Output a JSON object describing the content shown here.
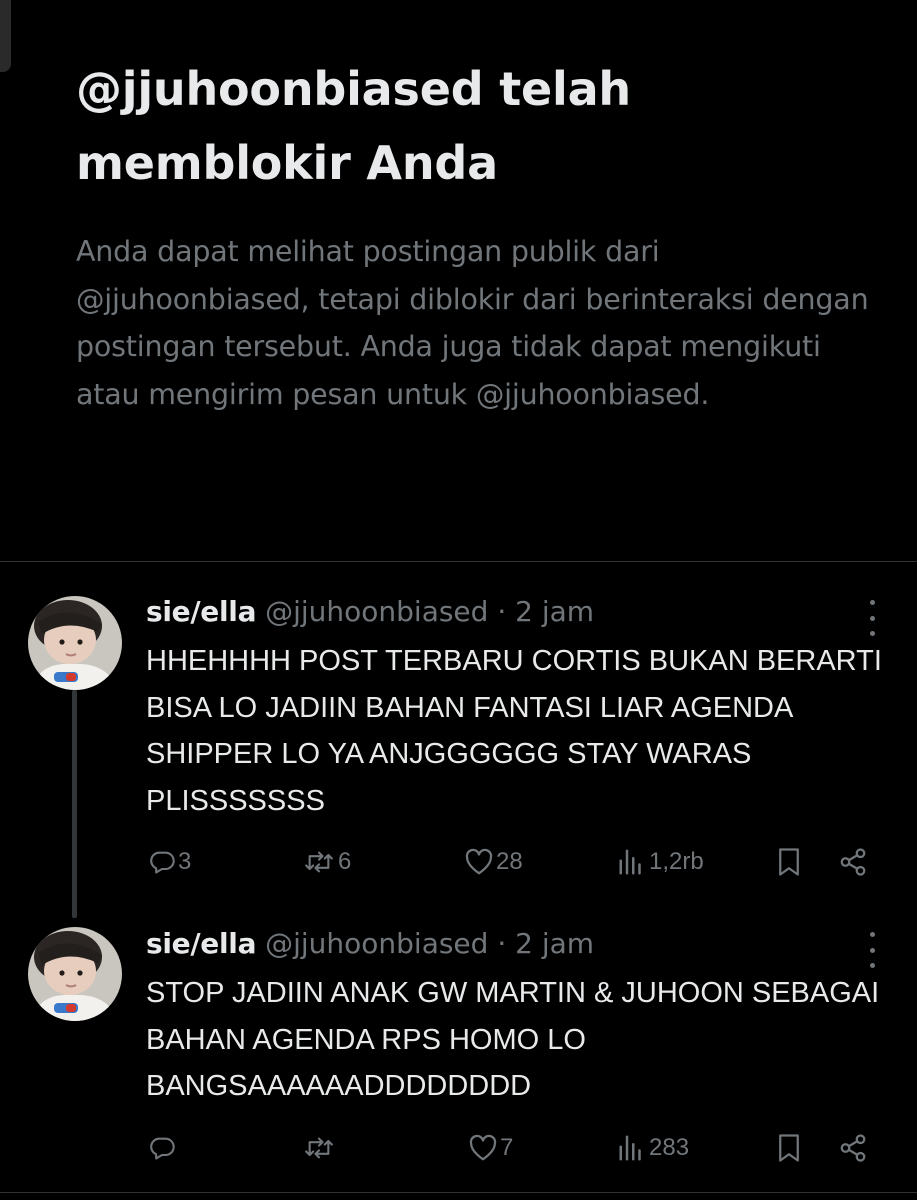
{
  "block_notice": {
    "title": "@jjuhoonbiased telah memblokir Anda",
    "description": "Anda dapat melihat postingan publik dari @jjuhoonbiased, tetapi diblokir dari berinteraksi dengan postingan tersebut. Anda juga tidak dapat mengikuti atau mengirim pesan untuk @jjuhoonbiased."
  },
  "tweets": [
    {
      "name": "sie/ella",
      "handle": "@jjuhoonbiased",
      "separator": "·",
      "time": "2 jam",
      "text": "HHEHHHH POST TERBARU CORTIS BUKAN BERARTI BISA LO JADIIN BAHAN FANTASI LIAR AGENDA SHIPPER LO YA ANJGGGGGG STAY WARAS PLISSSSSSS",
      "replies": "3",
      "reposts": "6",
      "likes": "28",
      "views": "1,2rb"
    },
    {
      "name": "sie/ella",
      "handle": "@jjuhoonbiased",
      "separator": "·",
      "time": "2 jam",
      "text": "STOP JADIIN ANAK GW MARTIN & JUHOON SEBAGAI BAHAN AGENDA RPS HOMO LO BANGSAAAAAADDDDDDDD",
      "replies": "",
      "reposts": "",
      "likes": "7",
      "views": "283"
    }
  ],
  "icons": {
    "reply": "reply-icon",
    "repost": "repost-icon",
    "like": "heart-icon",
    "views": "views-icon",
    "bookmark": "bookmark-icon",
    "share": "share-icon",
    "more": "more-icon"
  },
  "colors": {
    "background": "#000000",
    "primary_text": "#e7e9ea",
    "secondary_text": "#71767b",
    "divider": "#2f3336"
  }
}
